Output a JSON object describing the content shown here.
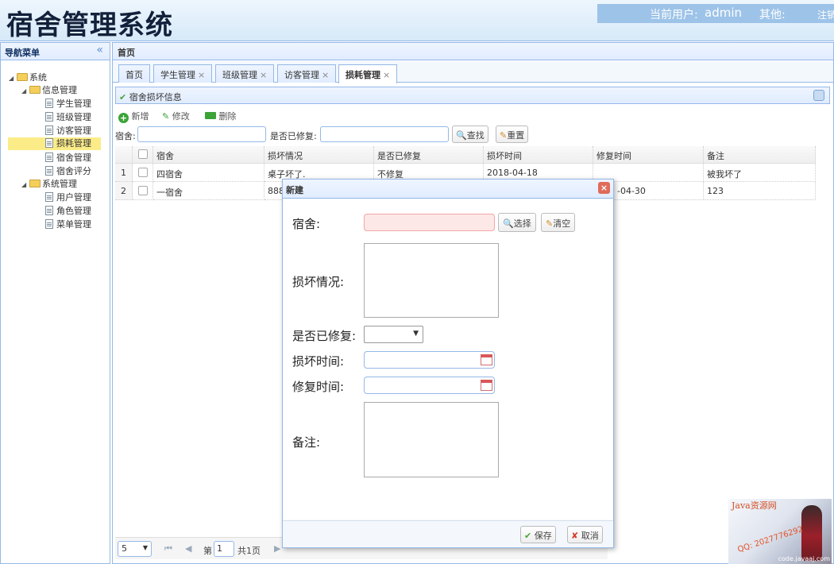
{
  "header": {
    "logo": "宿舍管理系统",
    "current_user_label": "当前用户:",
    "current_user": "admin",
    "other_label": "其他:",
    "logout": "注销"
  },
  "sidebar": {
    "title": "导航菜单",
    "collapse_glyph": "«",
    "tree": {
      "root": "系统",
      "info_group": "信息管理",
      "info_items": [
        "学生管理",
        "班级管理",
        "访客管理",
        "损耗管理",
        "宿舍管理",
        "宿舍评分"
      ],
      "sys_group": "系统管理",
      "sys_items": [
        "用户管理",
        "角色管理",
        "菜单管理"
      ]
    }
  },
  "main": {
    "title": "首页",
    "tabs": [
      {
        "label": "首页"
      },
      {
        "label": "学生管理"
      },
      {
        "label": "班级管理"
      },
      {
        "label": "访客管理"
      },
      {
        "label": "损耗管理"
      }
    ],
    "close_glyph": "×",
    "panel_title": "宿舍损坏信息",
    "toolbar": {
      "add": "新增",
      "edit": "修改",
      "delete": "删除"
    },
    "search": {
      "dorm_label": "宿舍:",
      "repaired_label": "是否已修复:",
      "search_btn": "查找",
      "reset_btn": "重置"
    },
    "grid": {
      "headers": [
        "宿舍",
        "损坏情况",
        "是否已修复",
        "损坏时间",
        "修复时间",
        "备注"
      ],
      "rows": [
        {
          "no": "1",
          "dorm": "四宿舍",
          "damage": "桌子坏了.",
          "repaired": "不修复",
          "damage_time": "2018-04-18",
          "repair_time": "",
          "remark": "被我坏了"
        },
        {
          "no": "2",
          "dorm": "一宿舍",
          "damage": "888",
          "repaired": "",
          "damage_time": "",
          "repair_time": "-04-30",
          "remark": "123"
        }
      ]
    },
    "pager": {
      "page_size": "5",
      "page_label": "第",
      "page_value": "1",
      "total_label": "共1页"
    }
  },
  "dialog": {
    "title": "新建",
    "close_glyph": "×",
    "fields": {
      "dorm": "宿舍:",
      "damage": "损坏情况:",
      "repaired": "是否已修复:",
      "damage_time": "损坏时间:",
      "repair_time": "修复时间:",
      "remark": "备注:"
    },
    "select_btn": "选择",
    "clear_btn": "清空",
    "save_btn": "保存",
    "cancel_btn": "取消",
    "select_arrow": "▼"
  },
  "watermark": "code.javaaj.com",
  "ad": {
    "title": "Java资源网",
    "qq": "QQ: 2027776292",
    "url": "code.javaaj.com"
  },
  "colors": {
    "accent": "#95b8e7",
    "header_bg": "#e0ecff",
    "selected": "#fbec88",
    "green_icon": "#3ba338",
    "watermark": "#d9731c"
  }
}
